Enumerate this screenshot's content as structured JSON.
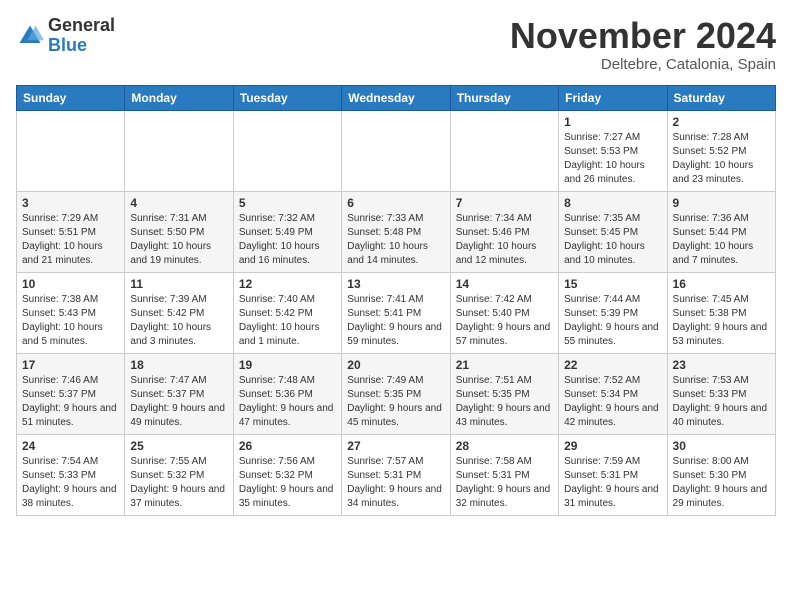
{
  "header": {
    "logo_general": "General",
    "logo_blue": "Blue",
    "month": "November 2024",
    "location": "Deltebre, Catalonia, Spain"
  },
  "weekdays": [
    "Sunday",
    "Monday",
    "Tuesday",
    "Wednesday",
    "Thursday",
    "Friday",
    "Saturday"
  ],
  "weeks": [
    [
      {
        "day": "",
        "info": ""
      },
      {
        "day": "",
        "info": ""
      },
      {
        "day": "",
        "info": ""
      },
      {
        "day": "",
        "info": ""
      },
      {
        "day": "",
        "info": ""
      },
      {
        "day": "1",
        "info": "Sunrise: 7:27 AM\nSunset: 5:53 PM\nDaylight: 10 hours and 26 minutes."
      },
      {
        "day": "2",
        "info": "Sunrise: 7:28 AM\nSunset: 5:52 PM\nDaylight: 10 hours and 23 minutes."
      }
    ],
    [
      {
        "day": "3",
        "info": "Sunrise: 7:29 AM\nSunset: 5:51 PM\nDaylight: 10 hours and 21 minutes."
      },
      {
        "day": "4",
        "info": "Sunrise: 7:31 AM\nSunset: 5:50 PM\nDaylight: 10 hours and 19 minutes."
      },
      {
        "day": "5",
        "info": "Sunrise: 7:32 AM\nSunset: 5:49 PM\nDaylight: 10 hours and 16 minutes."
      },
      {
        "day": "6",
        "info": "Sunrise: 7:33 AM\nSunset: 5:48 PM\nDaylight: 10 hours and 14 minutes."
      },
      {
        "day": "7",
        "info": "Sunrise: 7:34 AM\nSunset: 5:46 PM\nDaylight: 10 hours and 12 minutes."
      },
      {
        "day": "8",
        "info": "Sunrise: 7:35 AM\nSunset: 5:45 PM\nDaylight: 10 hours and 10 minutes."
      },
      {
        "day": "9",
        "info": "Sunrise: 7:36 AM\nSunset: 5:44 PM\nDaylight: 10 hours and 7 minutes."
      }
    ],
    [
      {
        "day": "10",
        "info": "Sunrise: 7:38 AM\nSunset: 5:43 PM\nDaylight: 10 hours and 5 minutes."
      },
      {
        "day": "11",
        "info": "Sunrise: 7:39 AM\nSunset: 5:42 PM\nDaylight: 10 hours and 3 minutes."
      },
      {
        "day": "12",
        "info": "Sunrise: 7:40 AM\nSunset: 5:42 PM\nDaylight: 10 hours and 1 minute."
      },
      {
        "day": "13",
        "info": "Sunrise: 7:41 AM\nSunset: 5:41 PM\nDaylight: 9 hours and 59 minutes."
      },
      {
        "day": "14",
        "info": "Sunrise: 7:42 AM\nSunset: 5:40 PM\nDaylight: 9 hours and 57 minutes."
      },
      {
        "day": "15",
        "info": "Sunrise: 7:44 AM\nSunset: 5:39 PM\nDaylight: 9 hours and 55 minutes."
      },
      {
        "day": "16",
        "info": "Sunrise: 7:45 AM\nSunset: 5:38 PM\nDaylight: 9 hours and 53 minutes."
      }
    ],
    [
      {
        "day": "17",
        "info": "Sunrise: 7:46 AM\nSunset: 5:37 PM\nDaylight: 9 hours and 51 minutes."
      },
      {
        "day": "18",
        "info": "Sunrise: 7:47 AM\nSunset: 5:37 PM\nDaylight: 9 hours and 49 minutes."
      },
      {
        "day": "19",
        "info": "Sunrise: 7:48 AM\nSunset: 5:36 PM\nDaylight: 9 hours and 47 minutes."
      },
      {
        "day": "20",
        "info": "Sunrise: 7:49 AM\nSunset: 5:35 PM\nDaylight: 9 hours and 45 minutes."
      },
      {
        "day": "21",
        "info": "Sunrise: 7:51 AM\nSunset: 5:35 PM\nDaylight: 9 hours and 43 minutes."
      },
      {
        "day": "22",
        "info": "Sunrise: 7:52 AM\nSunset: 5:34 PM\nDaylight: 9 hours and 42 minutes."
      },
      {
        "day": "23",
        "info": "Sunrise: 7:53 AM\nSunset: 5:33 PM\nDaylight: 9 hours and 40 minutes."
      }
    ],
    [
      {
        "day": "24",
        "info": "Sunrise: 7:54 AM\nSunset: 5:33 PM\nDaylight: 9 hours and 38 minutes."
      },
      {
        "day": "25",
        "info": "Sunrise: 7:55 AM\nSunset: 5:32 PM\nDaylight: 9 hours and 37 minutes."
      },
      {
        "day": "26",
        "info": "Sunrise: 7:56 AM\nSunset: 5:32 PM\nDaylight: 9 hours and 35 minutes."
      },
      {
        "day": "27",
        "info": "Sunrise: 7:57 AM\nSunset: 5:31 PM\nDaylight: 9 hours and 34 minutes."
      },
      {
        "day": "28",
        "info": "Sunrise: 7:58 AM\nSunset: 5:31 PM\nDaylight: 9 hours and 32 minutes."
      },
      {
        "day": "29",
        "info": "Sunrise: 7:59 AM\nSunset: 5:31 PM\nDaylight: 9 hours and 31 minutes."
      },
      {
        "day": "30",
        "info": "Sunrise: 8:00 AM\nSunset: 5:30 PM\nDaylight: 9 hours and 29 minutes."
      }
    ]
  ]
}
